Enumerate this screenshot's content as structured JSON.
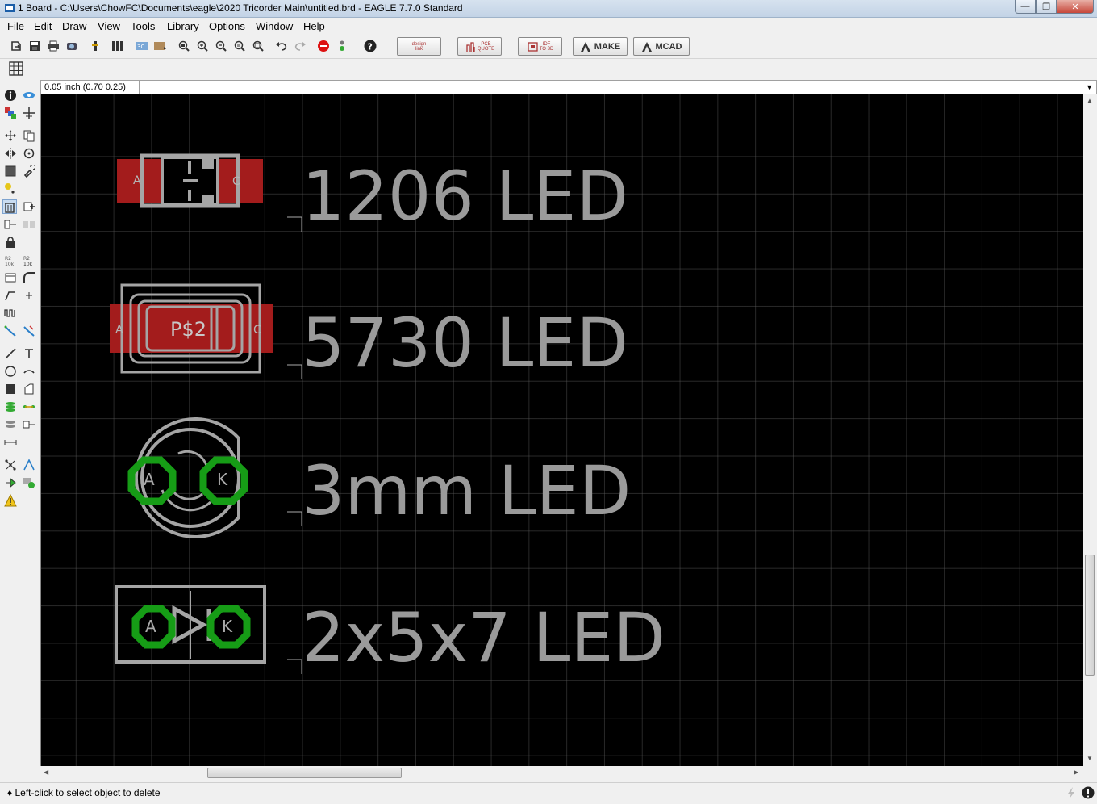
{
  "window": {
    "title": "1 Board - C:\\Users\\ChowFC\\Documents\\eagle\\2020 Tricorder Main\\untitled.brd - EAGLE 7.7.0 Standard",
    "minimize": "—",
    "restore": "❐",
    "close": "✕"
  },
  "menu": [
    "File",
    "Edit",
    "Draw",
    "View",
    "Tools",
    "Library",
    "Options",
    "Window",
    "Help"
  ],
  "toolbar": {
    "design_link_1": "design",
    "design_link_2": "link",
    "pcb_quote_1": "PCB",
    "pcb_quote_2": "QUOTE",
    "idf_1": "IDF",
    "idf_2": "TO 3D",
    "make": "MAKE",
    "mcad": "MCAD"
  },
  "coord_display": "0.05 inch (0.70 0.25)",
  "command_input": "",
  "board": {
    "labels": [
      "1206 LED",
      "5730 LED",
      "3mm LED",
      "2x5x7 LED"
    ],
    "pad_anode": "A",
    "pad_cathode": "K",
    "pad_5730_name": "P$2",
    "smd_a": "A",
    "smd_c": "C"
  },
  "status": "Left-click to select object to delete",
  "colors": {
    "canvas_bg": "#000000",
    "grid": "#5a5a5a",
    "silkscreen": "#a5a5a5",
    "smd_pad": "#a31c1c",
    "thru_pad": "#169c16",
    "label_text": "#9a9a9a"
  }
}
